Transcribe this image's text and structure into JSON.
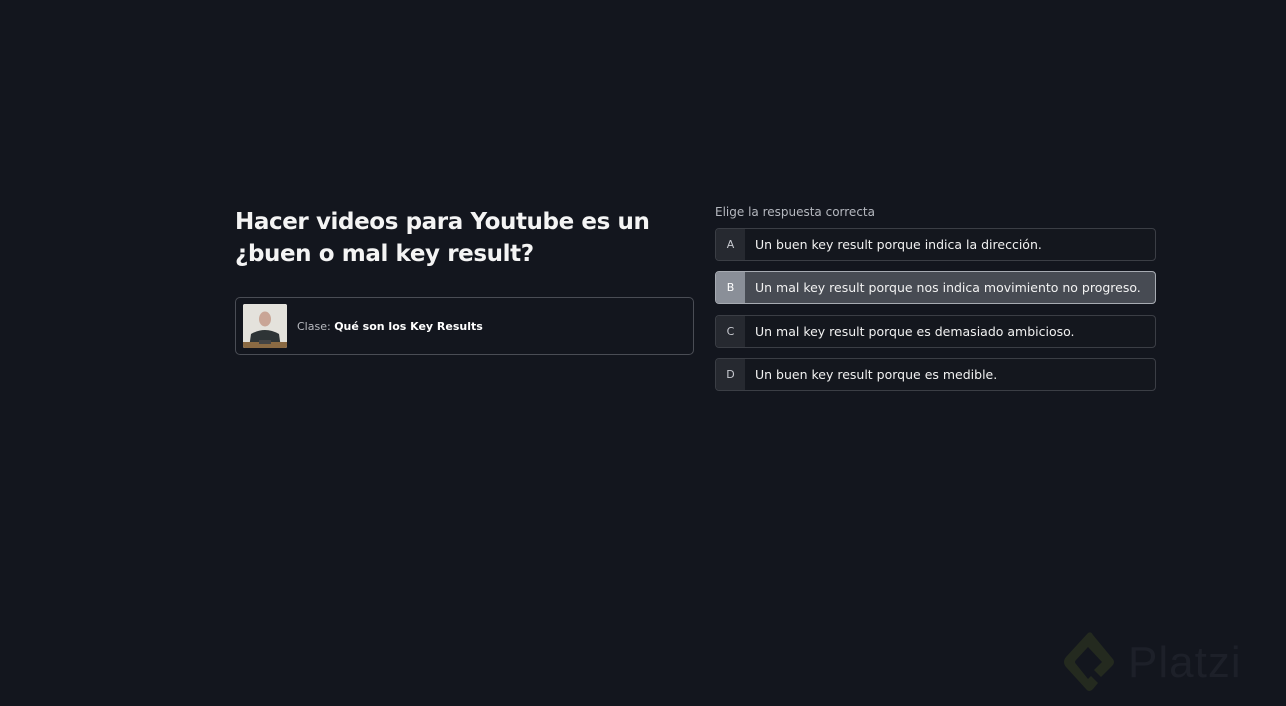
{
  "question": {
    "title": "Hacer videos para Youtube es un ¿buen o mal key result?"
  },
  "class_card": {
    "prefix": "Clase:",
    "name": "Qué son los Key Results"
  },
  "answers": {
    "prompt": "Elige la respuesta correcta",
    "options": [
      {
        "letter": "A",
        "text": "Un buen key result porque indica la dirección."
      },
      {
        "letter": "B",
        "text": "Un mal key result porque nos indica movimiento no progreso."
      },
      {
        "letter": "C",
        "text": "Un mal key result porque es demasiado ambicioso."
      },
      {
        "letter": "D",
        "text": "Un buen key result porque es medible."
      }
    ],
    "selected": "B"
  },
  "brand": {
    "logo_text": "Platzi",
    "accent": "#242a1f"
  }
}
